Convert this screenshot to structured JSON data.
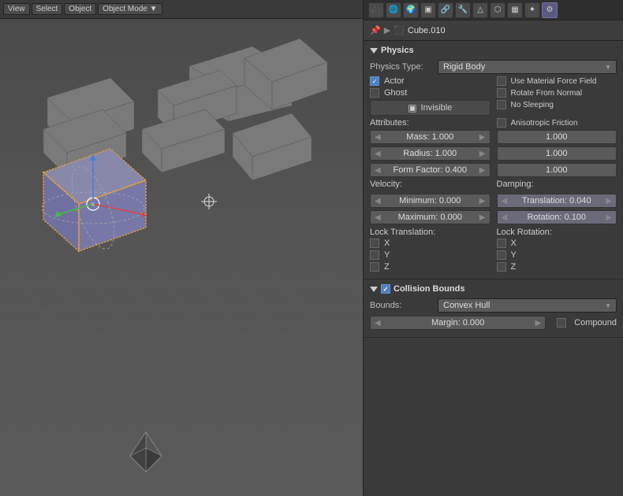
{
  "viewport": {
    "toolbar": {
      "buttons": [
        "View",
        "Select",
        "Object",
        "Object Mode",
        "▼"
      ]
    }
  },
  "panel": {
    "breadcrumb": {
      "cube_label": "Cube.010"
    },
    "physics": {
      "section_label": "Physics",
      "type_label": "Physics Type:",
      "type_value": "Rigid Body",
      "actor_label": "Actor",
      "actor_checked": true,
      "ghost_label": "Ghost",
      "ghost_checked": false,
      "invisible_icon": "▣",
      "invisible_label": "Invisible",
      "use_material_force_field_label": "Use Material Force Field",
      "use_material_force_field_checked": false,
      "rotate_from_normal_label": "Rotate From Normal",
      "rotate_from_normal_checked": false,
      "no_sleeping_label": "No Sleeping",
      "no_sleeping_checked": false,
      "attributes_label": "Attributes:",
      "mass_label": "Mass: 1.000",
      "radius_label": "Radius: 1.000",
      "form_factor_label": "Form Factor: 0.400",
      "anisotropic_friction_label": "Anisotropic Friction",
      "anisotropic_checked": false,
      "aniso_val1": "1.000",
      "aniso_val2": "1.000",
      "aniso_val3": "1.000",
      "velocity_label": "Velocity:",
      "damping_label": "Damping:",
      "minimum_label": "Minimum: 0.000",
      "maximum_label": "Maximum: 0.000",
      "translation_label": "Translation: 0.040",
      "rotation_label": "Rotation: 0.100",
      "lock_translation_label": "Lock Translation:",
      "lock_rotation_label": "Lock Rotation:",
      "lock_axes": [
        "X",
        "Y",
        "Z"
      ],
      "collision_bounds_label": "Collision Bounds",
      "collision_checked": true,
      "bounds_label": "Bounds:",
      "bounds_value": "Convex Hull",
      "margin_label": "Margin: 0.000",
      "compound_label": "Compound",
      "compound_checked": false
    }
  }
}
